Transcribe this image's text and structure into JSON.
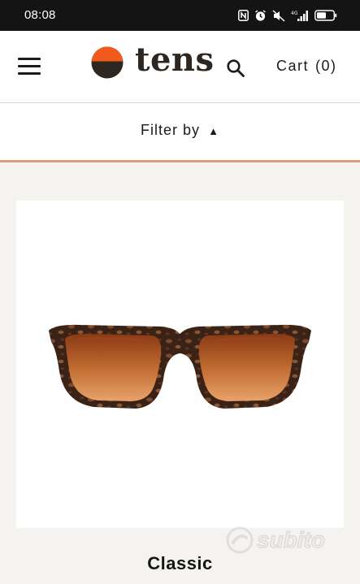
{
  "status_bar": {
    "time": "08:08",
    "icons": [
      "nfc-icon",
      "alarm-icon",
      "mute-icon",
      "signal-4g-icon",
      "battery-icon"
    ]
  },
  "header": {
    "logo_text": "tens",
    "cart_label": "Cart",
    "cart_count": "(0)",
    "colors": {
      "logo_orange": "#f05a1a",
      "logo_dark": "#2e2620"
    }
  },
  "filter": {
    "label": "Filter by",
    "arrow": "▲",
    "accent_color": "#d9a179"
  },
  "product": {
    "name": "Classic"
  },
  "watermark": {
    "text": "subito"
  }
}
